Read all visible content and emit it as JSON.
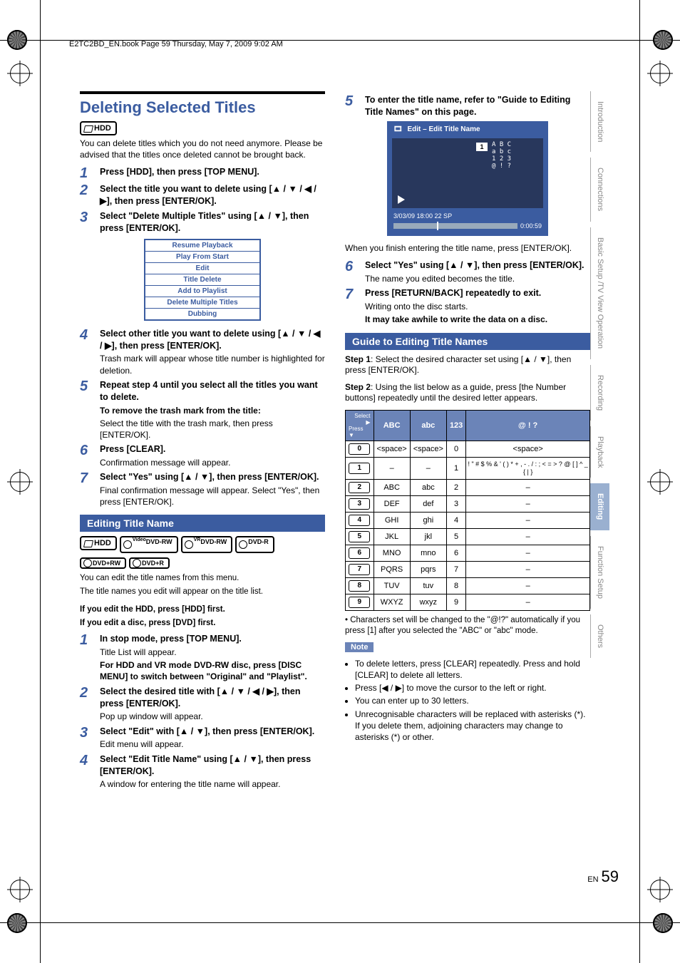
{
  "meta": {
    "header_line": "E2TC2BD_EN.book  Page 59  Thursday, May 7, 2009  9:02 AM"
  },
  "left": {
    "title": "Deleting Selected Titles",
    "hdd_badge": "HDD",
    "intro": "You can delete titles which you do not need anymore. Please be advised that the titles once deleted cannot be brought back.",
    "steps": [
      {
        "n": "1",
        "t": "Press [HDD], then press [TOP MENU]."
      },
      {
        "n": "2",
        "t": "Select the title you want to delete using [▲ / ▼ / ◀ / ▶], then press [ENTER/OK]."
      },
      {
        "n": "3",
        "t": "Select \"Delete Multiple Titles\" using [▲ / ▼], then press [ENTER/OK]."
      }
    ],
    "popup": [
      "Resume Playback",
      "Play From Start",
      "Edit",
      "Title Delete",
      "Add to Playlist",
      "Delete Multiple Titles",
      "Dubbing"
    ],
    "steps2": [
      {
        "n": "4",
        "t": "Select other title you want to delete using [▲ / ▼ / ◀ / ▶], then press [ENTER/OK].",
        "sub": "Trash mark will appear whose title number is highlighted for deletion."
      },
      {
        "n": "5",
        "t": "Repeat step 4 until you select all the titles you want to delete.",
        "sub2": "To remove the trash mark from the title:",
        "sub3": "Select the title with the trash mark, then press [ENTER/OK]."
      },
      {
        "n": "6",
        "t": "Press [CLEAR].",
        "sub": "Confirmation message will appear."
      },
      {
        "n": "7",
        "t": "Select \"Yes\" using [▲ / ▼], then press [ENTER/OK].",
        "sub": "Final confirmation message will appear. Select \"Yes\", then press [ENTER/OK]."
      }
    ],
    "edit_name_heading": "Editing Title Name",
    "disc_badges_a": [
      {
        "t": "HDD"
      },
      {
        "t": "DVD-RW",
        "sup": "Video"
      },
      {
        "t": "DVD-RW",
        "sup": "VR"
      },
      {
        "t": "DVD-R"
      }
    ],
    "disc_badges_b": [
      {
        "t": "DVD+RW"
      },
      {
        "t": "DVD+R"
      }
    ],
    "edit_intro1": "You can edit the title names from this menu.",
    "edit_intro2": "The title names you edit will appear on the title list.",
    "edit_note1": "If you edit the HDD, press [HDD] first.",
    "edit_note2": "If you edit a disc, press [DVD] first.",
    "edit_steps": [
      {
        "n": "1",
        "t": "In stop mode, press [TOP MENU].",
        "sub": "Title List will appear.",
        "sub2": "For HDD and VR mode DVD-RW disc, press [DISC MENU] to switch between \"Original\" and \"Playlist\"."
      },
      {
        "n": "2",
        "t": "Select the desired title with [▲ / ▼ / ◀ / ▶], then press [ENTER/OK].",
        "sub": "Pop up window will appear."
      },
      {
        "n": "3",
        "t": "Select \"Edit\" with [▲ / ▼], then press [ENTER/OK].",
        "sub": "Edit menu will appear."
      },
      {
        "n": "4",
        "t": "Select \"Edit Title Name\" using [▲ / ▼], then press [ENTER/OK].",
        "sub": "A window for entering the title name will appear."
      }
    ]
  },
  "right": {
    "steps": [
      {
        "n": "5",
        "t": "To enter the title name, refer to \"Guide to Editing Title Names\" on this page."
      }
    ],
    "tv": {
      "title": "Edit – Edit Title Name",
      "box1": "1",
      "grid_lines": [
        "A B C",
        "a b c",
        "1 2 3",
        "@ ! ?"
      ],
      "status_left": "3/03/09 18:00 22 SP",
      "time_right": "0:00:59"
    },
    "after_tv": "When you finish entering the title name, press [ENTER/OK].",
    "steps2": [
      {
        "n": "6",
        "t": "Select \"Yes\" using [▲ / ▼], then press [ENTER/OK].",
        "sub": "The name you edited becomes the title."
      },
      {
        "n": "7",
        "t": "Press [RETURN/BACK] repeatedly to exit.",
        "sub": "Writing onto the disc starts.",
        "sub2": "It may take awhile to write the data on a disc."
      }
    ],
    "guide_heading": "Guide to Editing Title Names",
    "guide_step1_lead": "Step 1",
    "guide_step1": ": Select the desired character set using [▲ / ▼], then press [ENTER/OK].",
    "guide_step2_lead": "Step 2",
    "guide_step2": ": Using the list below as a guide, press [the Number buttons] repeatedly until the desired letter appears.",
    "table": {
      "corner_top": "Select",
      "corner_bottom": "Press",
      "headers": [
        "ABC",
        "abc",
        "123",
        "@ ! ?"
      ],
      "rows": [
        {
          "key": "0",
          "cells": [
            "<space>",
            "<space>",
            "0",
            "<space>"
          ]
        },
        {
          "key": "1",
          "cells": [
            "–",
            "–",
            "1",
            "! \" # $ % & ' ( ) * + , - . / : ; < = > ? @ [ ] ^ _ { | }"
          ]
        },
        {
          "key": "2",
          "cells": [
            "ABC",
            "abc",
            "2",
            "–"
          ]
        },
        {
          "key": "3",
          "cells": [
            "DEF",
            "def",
            "3",
            "–"
          ]
        },
        {
          "key": "4",
          "cells": [
            "GHI",
            "ghi",
            "4",
            "–"
          ]
        },
        {
          "key": "5",
          "cells": [
            "JKL",
            "jkl",
            "5",
            "–"
          ]
        },
        {
          "key": "6",
          "cells": [
            "MNO",
            "mno",
            "6",
            "–"
          ]
        },
        {
          "key": "7",
          "cells": [
            "PQRS",
            "pqrs",
            "7",
            "–"
          ]
        },
        {
          "key": "8",
          "cells": [
            "TUV",
            "tuv",
            "8",
            "–"
          ]
        },
        {
          "key": "9",
          "cells": [
            "WXYZ",
            "wxyz",
            "9",
            "–"
          ]
        }
      ]
    },
    "table_note": "Characters set will be changed to the \"@!?\" automatically if you press [1] after you selected the \"ABC\" or \"abc\" mode.",
    "note_label": "Note",
    "notes": [
      "To delete letters, press [CLEAR] repeatedly. Press and hold [CLEAR] to delete all letters.",
      "Press [◀ / ▶] to move the cursor to the left or right.",
      "You can enter up to 30 letters.",
      "Unrecognisable characters will be replaced with asterisks (*). If you delete them, adjoining characters may change to asterisks (*) or other."
    ]
  },
  "tabs": [
    {
      "t": "Introduction",
      "active": false
    },
    {
      "t": "Connections",
      "active": false
    },
    {
      "t": "Basic Setup /\nTV View Operation",
      "active": false,
      "double": true
    },
    {
      "t": "Recording",
      "active": false
    },
    {
      "t": "Playback",
      "active": false
    },
    {
      "t": "Editing",
      "active": true
    },
    {
      "t": "Function Setup",
      "active": false
    },
    {
      "t": "Others",
      "active": false
    }
  ],
  "page_en": "EN",
  "page_num": "59"
}
